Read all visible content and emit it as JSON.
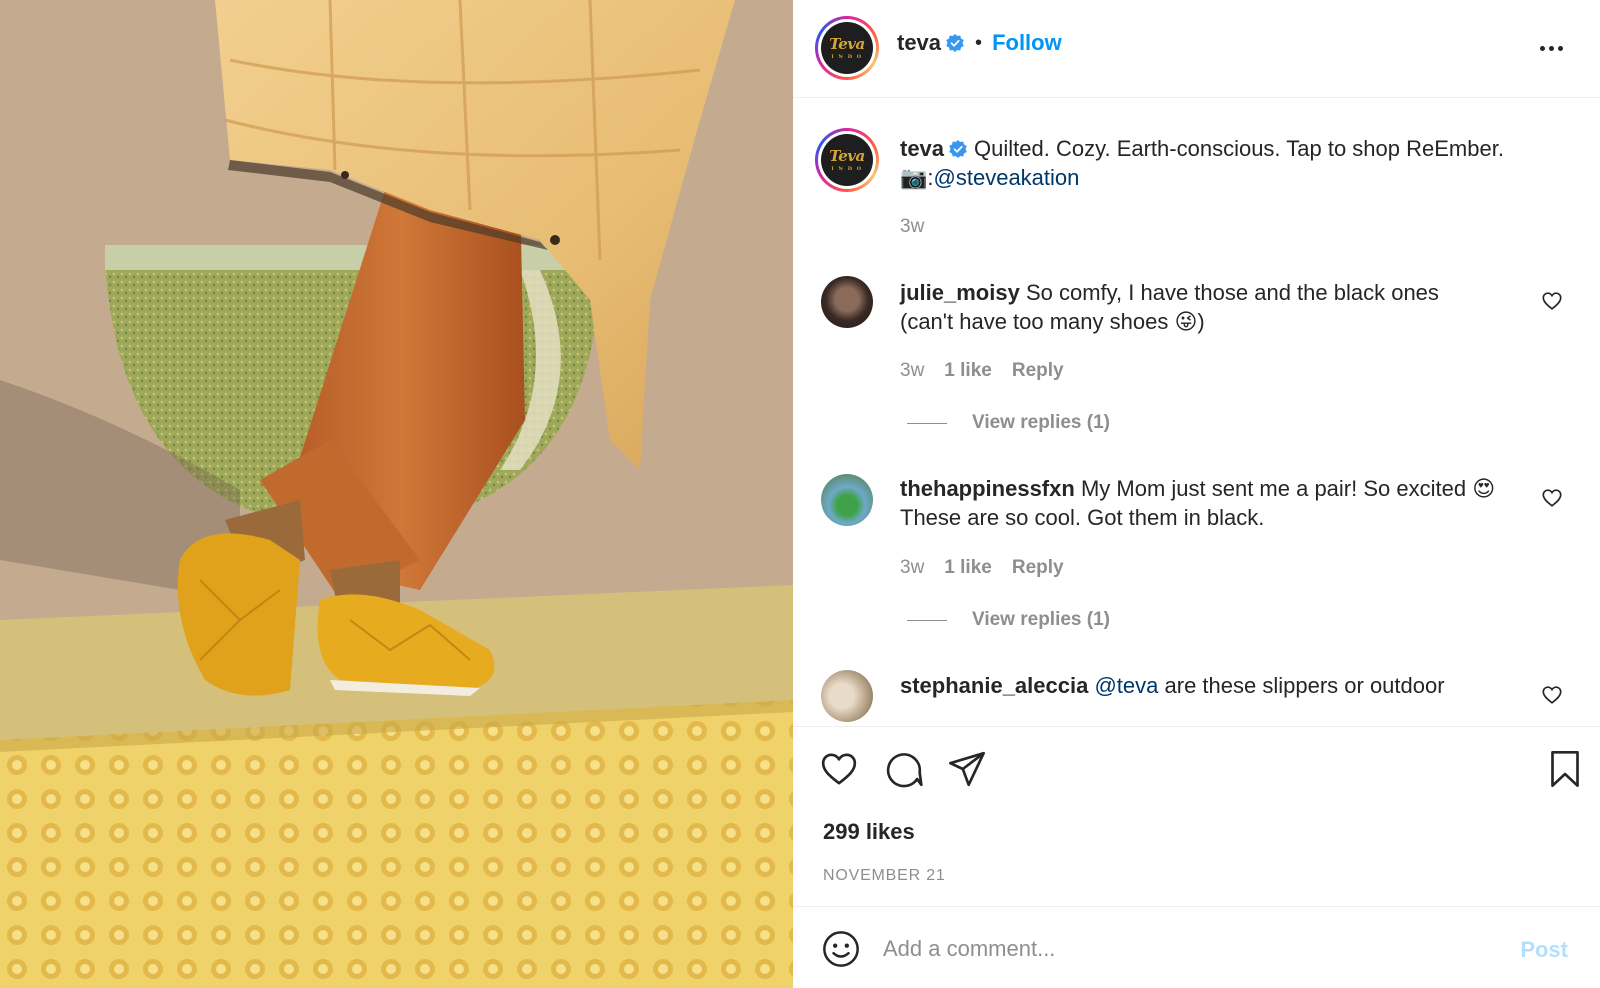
{
  "post": {
    "author": "teva",
    "follow_label": "Follow",
    "separator": "•",
    "avatar_logo_text": "Teva",
    "avatar_logo_subtext": "I N D O"
  },
  "caption": {
    "username": "teva",
    "text": "Quilted. Cozy. Earth-conscious. Tap to shop ReEmber.",
    "camera_emoji": "📷",
    "credit_prefix": ":",
    "credit_mention": "@steveakation",
    "time": "3w"
  },
  "comments": [
    {
      "username": "julie_moisy",
      "text_line1": "So comfy, I have those and the black ones",
      "text_line2": "(can't have too many shoes 😜)",
      "time": "3w",
      "likes": "1 like",
      "reply": "Reply",
      "view_replies": "View replies (1)"
    },
    {
      "username": "thehappinessfxn",
      "text_line1": "My Mom just sent me a pair! So excited 😍",
      "text_line2": "These are so cool. Got them in black.",
      "time": "3w",
      "likes": "1 like",
      "reply": "Reply",
      "view_replies": "View replies (1)"
    },
    {
      "username": "stephanie_aleccia",
      "mention": "@teva",
      "text_line1": "are these slippers or outdoor"
    }
  ],
  "actions": {
    "like_icon": "heart-icon",
    "comment_icon": "comment-icon",
    "share_icon": "paper-plane-icon",
    "save_icon": "bookmark-icon",
    "likes_count": "299 likes",
    "date": "NOVEMBER 21"
  },
  "add_comment": {
    "placeholder": "Add a comment...",
    "post_label": "Post",
    "emoji_icon": "smiley-icon"
  },
  "colors": {
    "accent": "#0095f6",
    "post_disabled": "#b2dffc",
    "mention": "#00376b",
    "muted": "#8e8e8e"
  }
}
